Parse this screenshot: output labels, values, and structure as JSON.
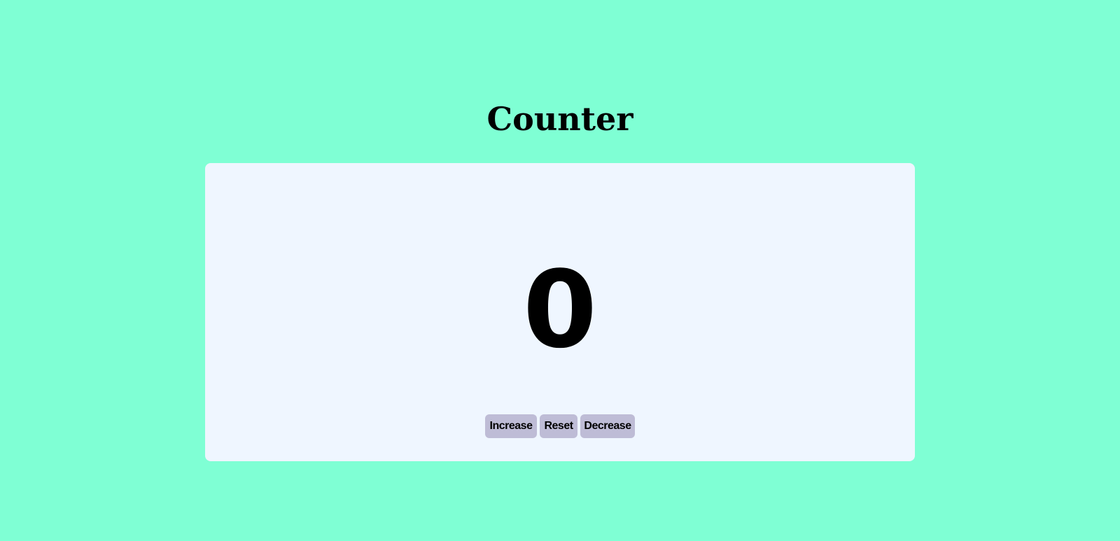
{
  "page": {
    "title": "Counter",
    "background_color": "#7fffd4"
  },
  "card": {
    "background_color": "#eff6ff",
    "count": "0"
  },
  "buttons": {
    "increase_label": "Increase",
    "reset_label": "Reset",
    "decrease_label": "Decrease",
    "background_color": "#bebcd6"
  }
}
